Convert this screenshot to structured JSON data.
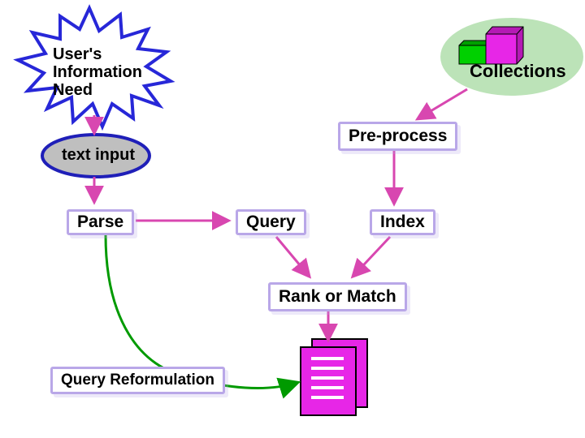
{
  "nodes": {
    "user_need": "User's\nInformation\nNeed",
    "collections": "Collections",
    "preprocess": "Pre-process",
    "text_input": "text input",
    "parse": "Parse",
    "query": "Query",
    "index": "Index",
    "rank": "Rank or Match",
    "reformulation": "Query Reformulation"
  },
  "colors": {
    "outline": "#b9a7e8",
    "arrow": "#d847b0",
    "starburst_stroke": "#2727d8",
    "ellipse_stroke": "#1f1fb8",
    "ellipse_fill": "#bfbfbf",
    "collections_ellipse": "#bce3b8",
    "cube_green": "#00d000",
    "cube_magenta": "#e726e7",
    "result_magenta": "#e726e7",
    "feedback_stroke": "#009a00"
  }
}
